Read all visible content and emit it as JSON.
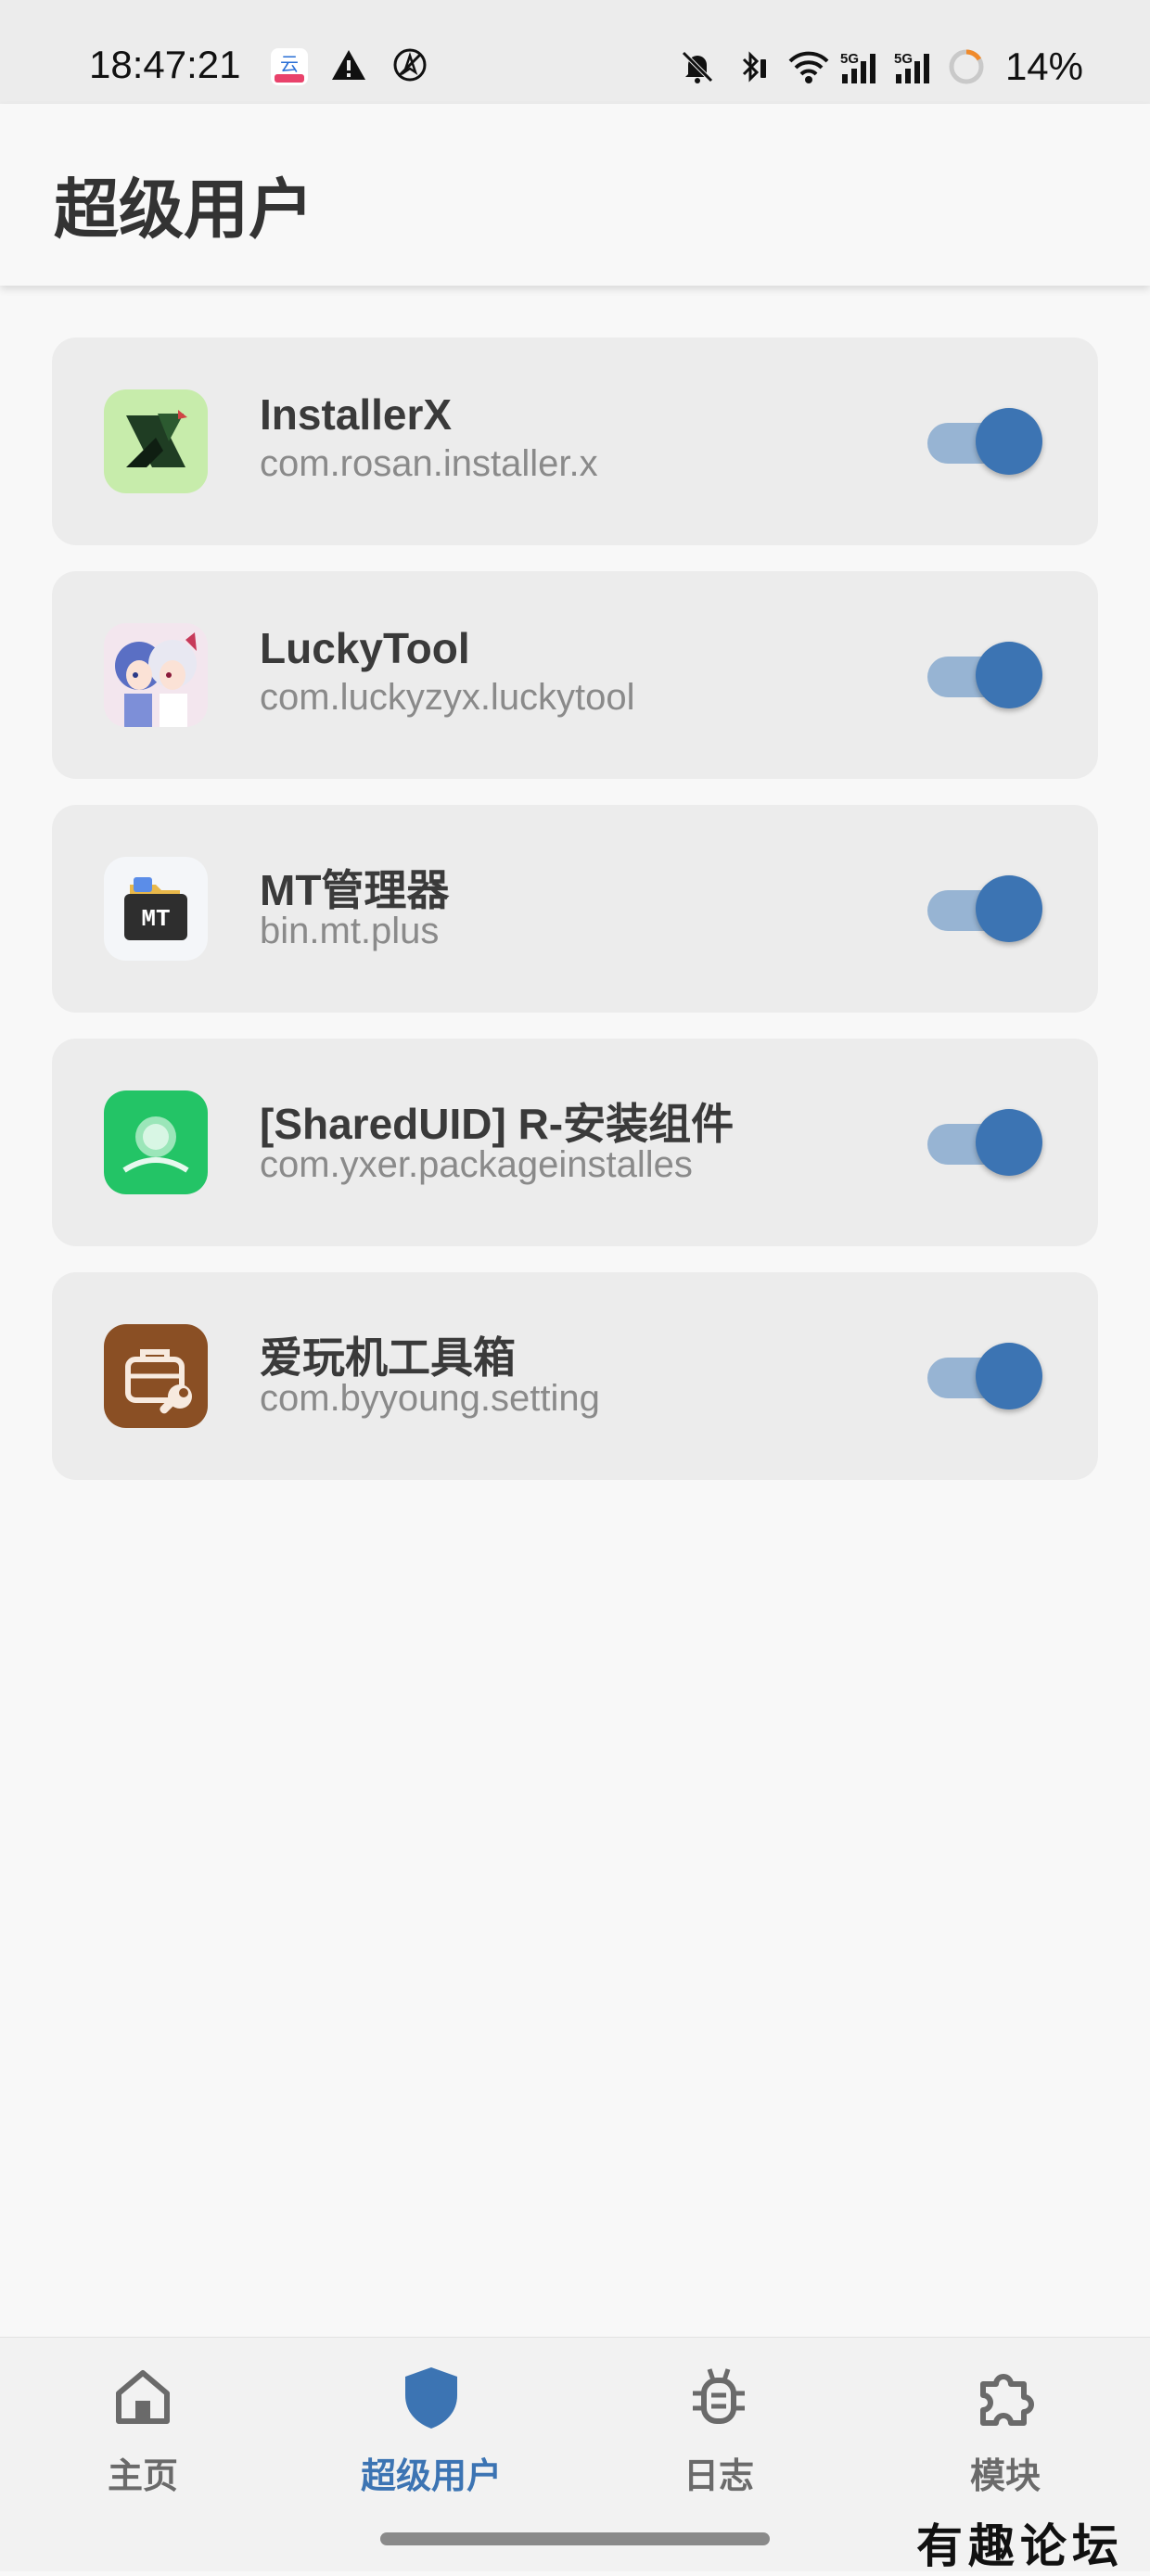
{
  "status_bar": {
    "time": "18:47:21",
    "battery": "14%",
    "left_icons": [
      "cloud-app-icon",
      "warning-icon",
      "location-off-icon"
    ],
    "right_icons": [
      "bell-off-icon",
      "bluetooth-icon",
      "wifi-icon",
      "5g-signal-icon",
      "5g-signal-icon",
      "battery-ring-icon"
    ]
  },
  "appbar": {
    "title": "超级用户"
  },
  "apps": [
    {
      "name": "InstallerX",
      "package": "com.rosan.installer.x",
      "enabled": true,
      "icon": "installerx-icon"
    },
    {
      "name": "LuckyTool",
      "package": "com.luckyzyx.luckytool",
      "enabled": true,
      "icon": "luckytool-icon"
    },
    {
      "name": "MT管理器",
      "package": "bin.mt.plus",
      "enabled": true,
      "icon": "mt-manager-icon",
      "icon_text": "MT"
    },
    {
      "name": "[SharedUID] R-安装组件",
      "package": "com.yxer.packageinstalles",
      "enabled": true,
      "icon": "package-installer-icon"
    },
    {
      "name": "爱玩机工具箱",
      "package": "com.byyoung.setting",
      "enabled": true,
      "icon": "toolbox-icon"
    }
  ],
  "bottom_nav": {
    "items": [
      {
        "label": "主页",
        "icon": "home-icon",
        "active": false
      },
      {
        "label": "超级用户",
        "icon": "shield-icon",
        "active": true
      },
      {
        "label": "日志",
        "icon": "bug-icon",
        "active": false
      },
      {
        "label": "模块",
        "icon": "puzzle-icon",
        "active": false
      }
    ]
  },
  "watermark": "有趣论坛",
  "colors": {
    "accent": "#3c74b3",
    "toggle_track": "#97b4d3",
    "card_bg": "#ececec",
    "page_bg": "#f8f8f8"
  }
}
